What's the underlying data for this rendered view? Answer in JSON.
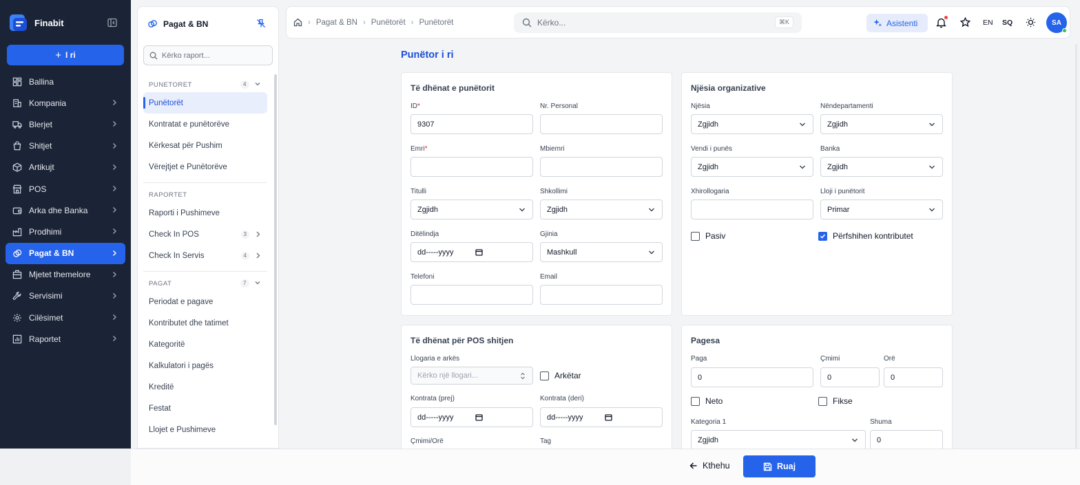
{
  "app": {
    "name": "Finabit"
  },
  "sidebar": {
    "new_label": "I ri",
    "items": [
      {
        "label": "Ballina",
        "icon": "dashboard-icon",
        "chevron": false
      },
      {
        "label": "Kompania",
        "icon": "building-icon",
        "chevron": true
      },
      {
        "label": "Blerjet",
        "icon": "truck-icon",
        "chevron": true
      },
      {
        "label": "Shitjet",
        "icon": "shopping-bag-icon",
        "chevron": true
      },
      {
        "label": "Artikujt",
        "icon": "box-icon",
        "chevron": true
      },
      {
        "label": "POS",
        "icon": "store-icon",
        "chevron": true
      },
      {
        "label": "Arka dhe Banka",
        "icon": "wallet-icon",
        "chevron": true
      },
      {
        "label": "Prodhimi",
        "icon": "factory-icon",
        "chevron": true
      },
      {
        "label": "Pagat & BN",
        "icon": "payroll-icon",
        "chevron": true,
        "active": true
      },
      {
        "label": "Mjetet themelore",
        "icon": "assets-icon",
        "chevron": true
      },
      {
        "label": "Servisimi",
        "icon": "wrench-icon",
        "chevron": true
      },
      {
        "label": "Cilësimet",
        "icon": "gear-icon",
        "chevron": true
      },
      {
        "label": "Raportet",
        "icon": "chart-icon",
        "chevron": true
      }
    ]
  },
  "subnav": {
    "title": "Pagat & BN",
    "search_placeholder": "Kërko raport...",
    "sections": [
      {
        "title": "PUNETORET",
        "count": "4",
        "items": [
          {
            "label": "Punëtorët",
            "active": true
          },
          {
            "label": "Kontratat e punëtorëve"
          },
          {
            "label": "Kërkesat për Pushim"
          },
          {
            "label": "Vërejtjet e Punëtorëve"
          }
        ]
      },
      {
        "title": "RAPORTET",
        "items": [
          {
            "label": "Raporti i Pushimeve"
          },
          {
            "label": "Check In POS",
            "count": "3",
            "chevron": true
          },
          {
            "label": "Check In Servis",
            "count": "4",
            "chevron": true
          }
        ]
      },
      {
        "title": "PAGAT",
        "count": "7",
        "items": [
          {
            "label": "Periodat e pagave"
          },
          {
            "label": "Kontributet dhe tatimet"
          },
          {
            "label": "Kategoritë"
          },
          {
            "label": "Kalkulatori i pagës"
          },
          {
            "label": "Kreditë"
          },
          {
            "label": "Festat"
          },
          {
            "label": "Llojet e Pushimeve"
          }
        ]
      }
    ]
  },
  "topbar": {
    "breadcrumb": [
      "Pagat & BN",
      "Punëtorët",
      "Punëtorët"
    ],
    "search_placeholder": "Kërko...",
    "shortcut": "⌘K",
    "assistant_label": "Asistenti",
    "lang_en": "EN",
    "lang_sq": "SQ",
    "avatar_initials": "SA"
  },
  "page": {
    "title": "Punëtor i ri"
  },
  "employee": {
    "title": "Të dhënat e punëtorit",
    "id_label": "ID",
    "id_value": "9307",
    "personal_label": "Nr. Personal",
    "first_name_label": "Emri",
    "last_name_label": "Mbiemri",
    "title_label": "Titulli",
    "title_value": "Zgjidh",
    "education_label": "Shkollimi",
    "education_value": "Zgjidh",
    "birthdate_label": "Ditëlindja",
    "birthdate_value": "dd-----yyyy",
    "gender_label": "Gjinia",
    "gender_value": "Mashkull",
    "phone_label": "Telefoni",
    "email_label": "Email"
  },
  "org": {
    "title": "Njësia organizative",
    "unit_label": "Njësia",
    "unit_value": "Zgjidh",
    "subdept_label": "Nëndepartamenti",
    "subdept_value": "Zgjidh",
    "workplace_label": "Vendi i punës",
    "workplace_value": "Zgjidh",
    "bank_label": "Banka",
    "bank_value": "Zgjidh",
    "account_label": "Xhirollogaria",
    "type_label": "Lloji i punëtorit",
    "type_value": "Primar",
    "passive_label": "Pasiv",
    "passive_checked": false,
    "contrib_label": "Përfshihen kontributet",
    "contrib_checked": true
  },
  "pos": {
    "title": "Të dhënat për POS shitjen",
    "account_label": "Llogaria e arkës",
    "account_placeholder": "Kërko një llogari...",
    "cashier_label": "Arkëtar",
    "contract_from_label": "Kontrata (prej)",
    "contract_from_value": "dd-----yyyy",
    "contract_to_label": "Kontrata (deri)",
    "contract_to_value": "dd-----yyyy",
    "price_hour_label": "Çmimi/Orë",
    "tag_label": "Tag"
  },
  "payment": {
    "title": "Pagesa",
    "salary_label": "Paga",
    "salary_value": "0",
    "price_label": "Çmimi",
    "price_value": "0",
    "hours_label": "Orë",
    "hours_value": "0",
    "net_label": "Neto",
    "fixed_label": "Fikse",
    "category_label": "Kategoria 1",
    "category_value": "Zgjidh",
    "amount_label": "Shuma",
    "amount_value": "0"
  },
  "footer": {
    "back_label": "Kthehu",
    "save_label": "Ruaj"
  }
}
